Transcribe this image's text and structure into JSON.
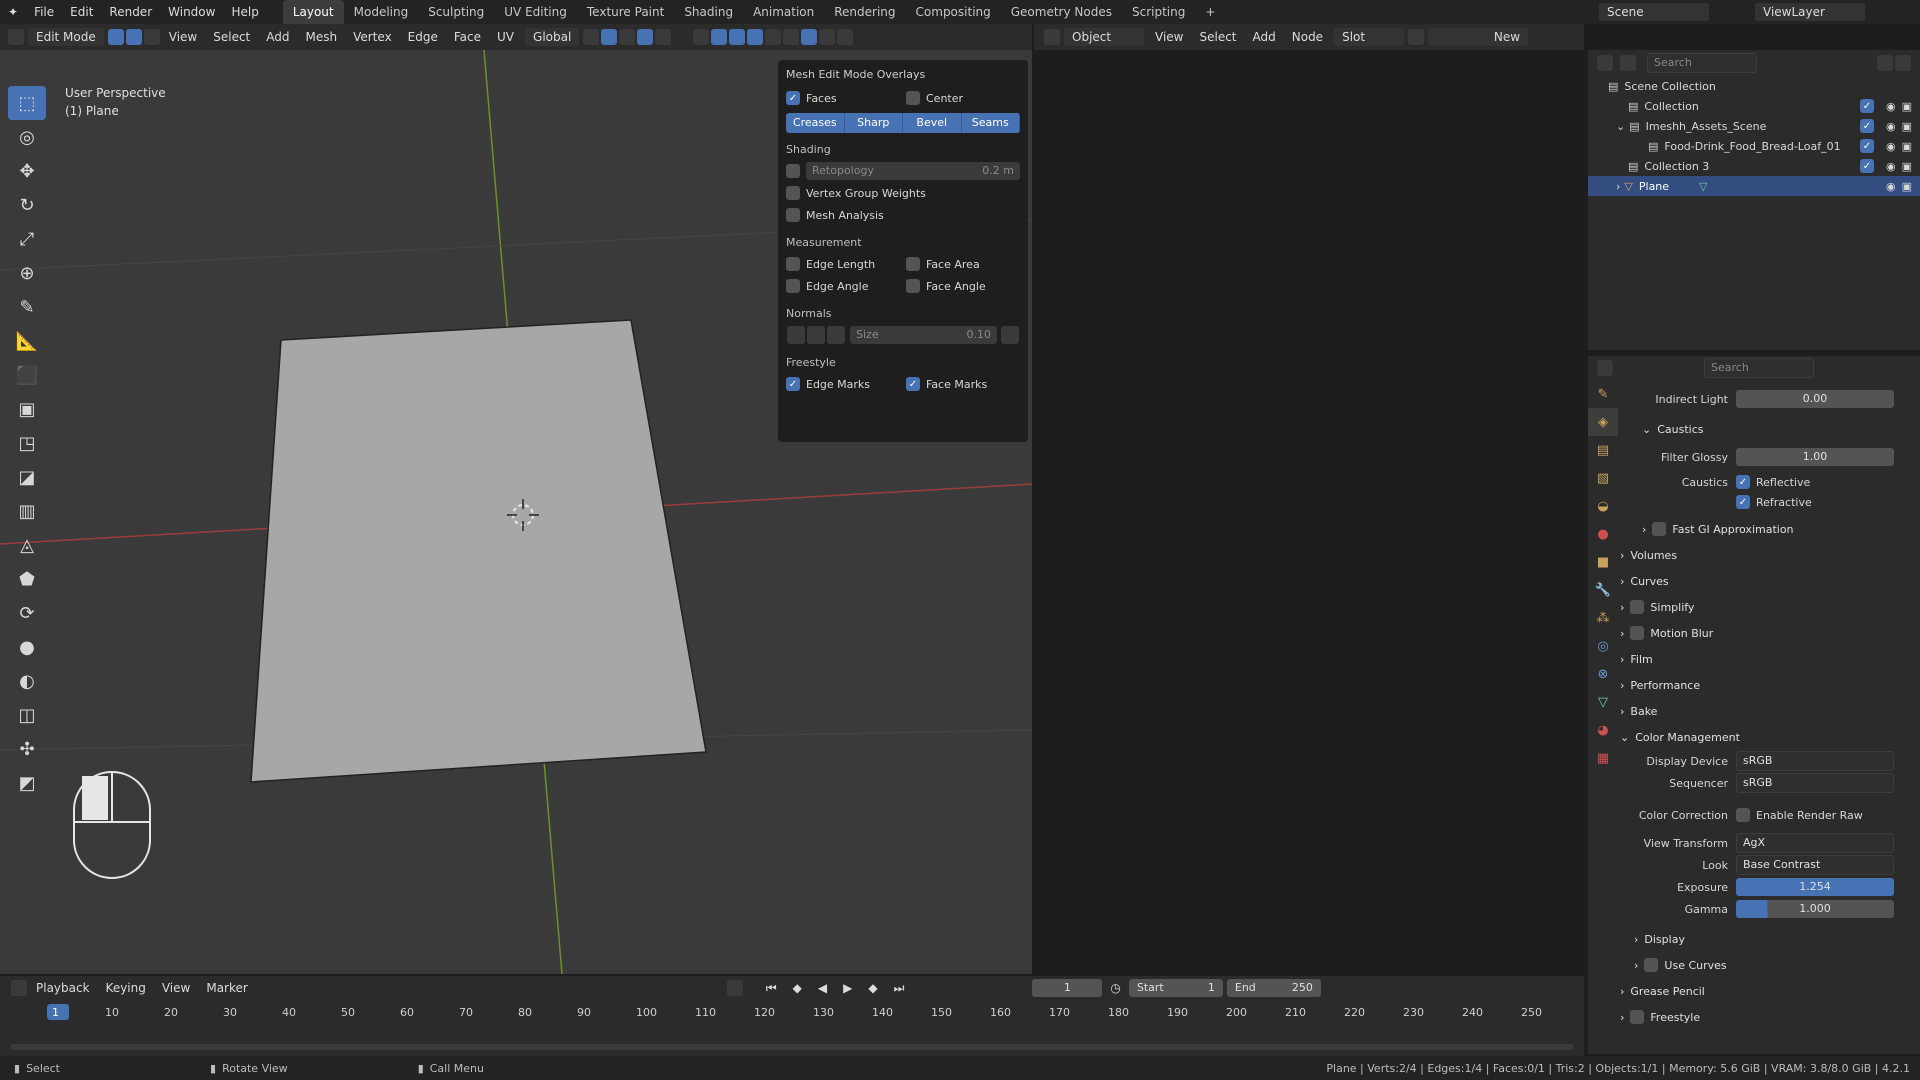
{
  "menubar": {
    "menus": [
      "File",
      "Edit",
      "Render",
      "Window",
      "Help"
    ],
    "workspaces": [
      "Layout",
      "Modeling",
      "Sculpting",
      "UV Editing",
      "Texture Paint",
      "Shading",
      "Animation",
      "Rendering",
      "Compositing",
      "Geometry Nodes",
      "Scripting"
    ],
    "active_workspace": "Layout",
    "scene": "Scene",
    "view_layer": "ViewLayer"
  },
  "viewport_header": {
    "mode": "Edit Mode",
    "menus": [
      "View",
      "Select",
      "Add",
      "Mesh",
      "Vertex",
      "Edge",
      "Face",
      "UV"
    ],
    "transform_orientation": "Global"
  },
  "viewport": {
    "view_name": "User Perspective",
    "object_name": "(1) Plane"
  },
  "shader_header": {
    "object_dropdown": "Object",
    "menus": [
      "View",
      "Select",
      "Add",
      "Node"
    ],
    "slot": "Slot",
    "new_button": "New"
  },
  "overlays_popup": {
    "title": "Mesh Edit Mode Overlays",
    "faces_label": "Faces",
    "center_label": "Center",
    "segments": [
      "Creases",
      "Sharp",
      "Bevel",
      "Seams"
    ],
    "shading_title": "Shading",
    "retopology_label": "Retopology",
    "retopology_value": "0.2 m",
    "vertex_group_weights": "Vertex Group Weights",
    "mesh_analysis": "Mesh Analysis",
    "measurement_title": "Measurement",
    "edge_length": "Edge Length",
    "face_area": "Face Area",
    "edge_angle": "Edge Angle",
    "face_angle": "Face Angle",
    "normals_title": "Normals",
    "size_label": "Size",
    "size_value": "0.10",
    "freestyle_title": "Freestyle",
    "edge_marks": "Edge Marks",
    "face_marks": "Face Marks"
  },
  "outliner": {
    "search_placeholder": "Search",
    "items": [
      {
        "label": "Scene Collection"
      },
      {
        "label": "Collection"
      },
      {
        "label": "Imeshh_Assets_Scene"
      },
      {
        "label": "Food-Drink_Food_Bread-Loaf_01"
      },
      {
        "label": "Collection 3"
      },
      {
        "label": "Plane"
      }
    ]
  },
  "properties": {
    "search_placeholder": "Search",
    "indirect_light_label": "Indirect Light",
    "indirect_light_value": "0.00",
    "caustics_section": "Caustics",
    "filter_glossy_label": "Filter Glossy",
    "filter_glossy_value": "1.00",
    "caustics_label": "Caustics",
    "reflective": "Reflective",
    "refractive": "Refractive",
    "fast_gi": "Fast GI Approximation",
    "panels": [
      "Volumes",
      "Curves",
      "Simplify",
      "Motion Blur",
      "Film",
      "Performance",
      "Bake"
    ],
    "color_management": "Color Management",
    "display_device_label": "Display Device",
    "display_device_value": "sRGB",
    "sequencer_label": "Sequencer",
    "sequencer_value": "sRGB",
    "color_correction_label": "Color Correction",
    "enable_render_raw": "Enable Render Raw",
    "view_transform_label": "View Transform",
    "view_transform_value": "AgX",
    "look_label": "Look",
    "look_value": "Base Contrast",
    "exposure_label": "Exposure",
    "exposure_value": "1.254",
    "gamma_label": "Gamma",
    "gamma_value": "1.000",
    "display_sub": "Display",
    "use_curves_sub": "Use Curves",
    "grease_pencil": "Grease Pencil",
    "freestyle": "Freestyle"
  },
  "timeline": {
    "menus": [
      "Playback",
      "Keying",
      "View",
      "Marker"
    ],
    "current_frame": "1",
    "start_label": "Start",
    "start_value": "1",
    "end_label": "End",
    "end_value": "250",
    "ticks": [
      "1",
      "10",
      "20",
      "30",
      "40",
      "50",
      "60",
      "70",
      "80",
      "90",
      "100",
      "110",
      "120",
      "130",
      "140",
      "150",
      "160",
      "170",
      "180",
      "190",
      "200",
      "210",
      "220",
      "230",
      "240",
      "250"
    ]
  },
  "statusbar": {
    "select": "Select",
    "rotate_view": "Rotate View",
    "call_menu": "Call Menu",
    "stats": "Plane | Verts:2/4 | Edges:1/4 | Faces:0/1 | Tris:2 | Objects:1/1 | Memory: 5.6 GiB | VRAM: 3.8/8.0 GiB | 4.2.1"
  },
  "colors": {
    "accent": "#4772b3",
    "background": "#1d1d1d",
    "panel": "#2b2b2b",
    "viewport": "#3a3a3a"
  }
}
